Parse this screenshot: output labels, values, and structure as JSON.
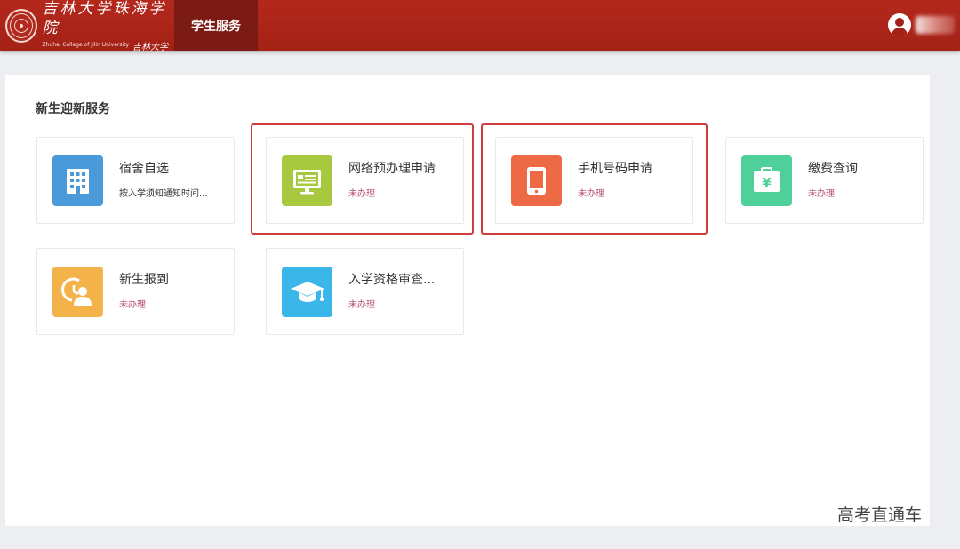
{
  "header": {
    "logo_cn": "吉林大学珠海学院",
    "logo_en": "Zhuhai College of Jilin University",
    "logo_sign": "吉林大学",
    "nav_tab": "学生服务"
  },
  "section": {
    "title": "新生迎新服务"
  },
  "cards": [
    {
      "title": "宿舍自选",
      "desc": "按入学须知通知时间...",
      "icon": "building-icon",
      "color": "#4a9ad9"
    },
    {
      "title": "网络预办理申请",
      "status": "未办理",
      "icon": "monitor-icon",
      "color": "#a8c83f"
    },
    {
      "title": "手机号码申请",
      "status": "未办理",
      "icon": "tablet-icon",
      "color": "#ee6a45"
    },
    {
      "title": "缴费查询",
      "status": "未办理",
      "icon": "yen-briefcase-icon",
      "color": "#4fd09a"
    },
    {
      "title": "新生报到",
      "status": "未办理",
      "icon": "clock-person-icon",
      "color": "#f4b24a"
    },
    {
      "title": "入学资格审查...",
      "status": "未办理",
      "icon": "graduation-cap-icon",
      "color": "#3ab6e8"
    }
  ],
  "watermark": "高考直通车",
  "colors": {
    "header_bg": "#a32116",
    "nav_active_bg": "#7a1a12",
    "status_text": "#b44b77",
    "highlight_border": "#cf3c3c"
  }
}
